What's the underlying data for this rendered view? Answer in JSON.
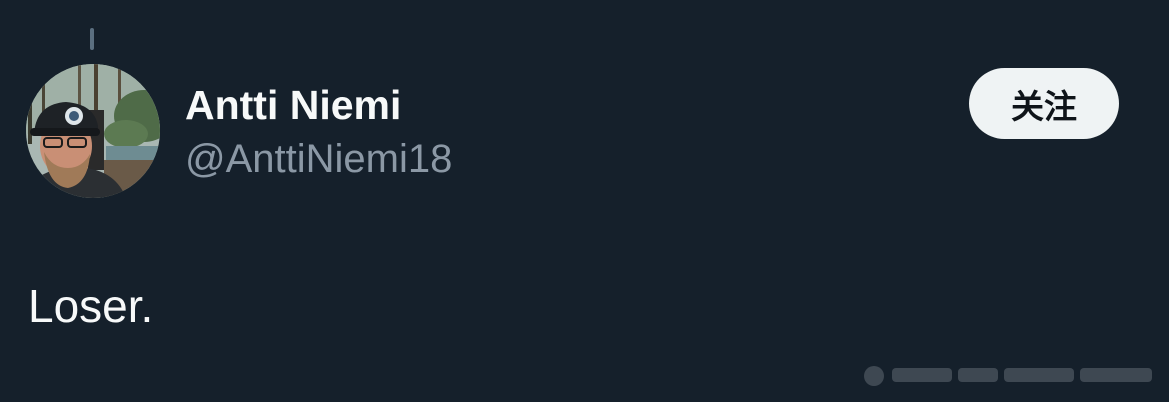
{
  "tweet": {
    "author": {
      "display_name": "Antti Niemi",
      "handle": "@AnttiNiemi18",
      "avatar_icon": "profile-photo"
    },
    "follow_label": "关注",
    "text": "Loser."
  },
  "colors": {
    "background": "#15202b",
    "primary_text": "#f7f9f9",
    "secondary_text": "#8b98a5",
    "follow_button_bg": "#eff3f4",
    "follow_button_text": "#0f1419"
  }
}
